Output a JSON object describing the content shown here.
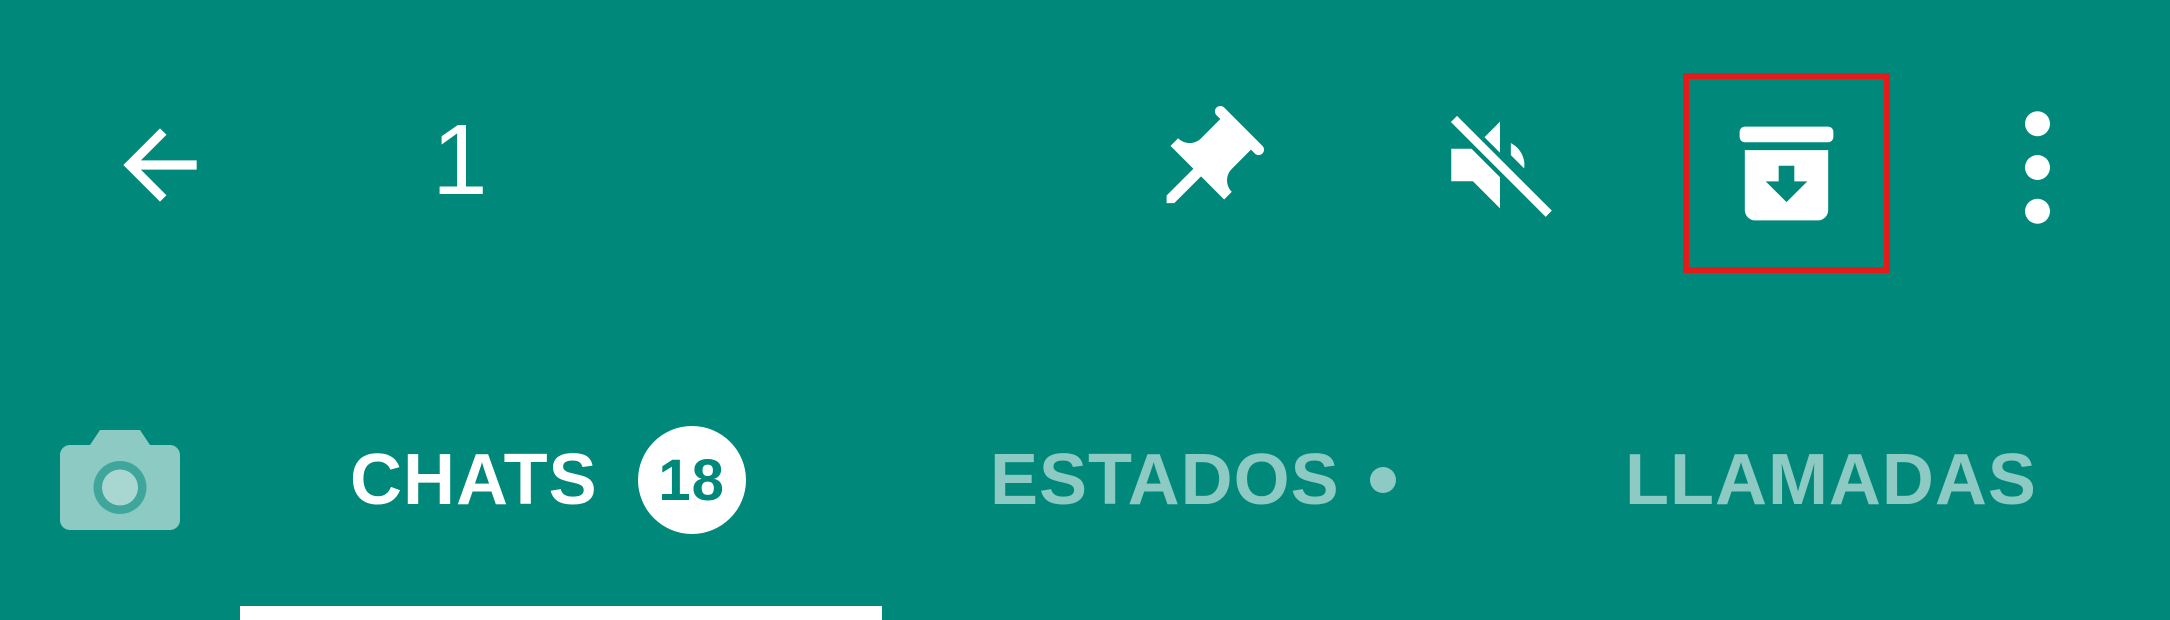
{
  "action_bar": {
    "selected_count": "1",
    "icons": {
      "back": "arrow-back-icon",
      "pin": "pin-icon",
      "mute": "mute-icon",
      "archive": "archive-icon",
      "more": "more-vert-icon"
    },
    "highlight_color": "#E41B1B"
  },
  "tabs": {
    "camera_icon": "camera-icon",
    "items": [
      {
        "label": "CHATS",
        "badge": "18",
        "active": true
      },
      {
        "label": "ESTADOS",
        "has_dot": true,
        "active": false
      },
      {
        "label": "LLAMADAS",
        "active": false
      }
    ]
  },
  "colors": {
    "primary": "#00897B",
    "on_primary": "#FFFFFF",
    "inactive_tab": "rgba(255,255,255,0.55)"
  }
}
